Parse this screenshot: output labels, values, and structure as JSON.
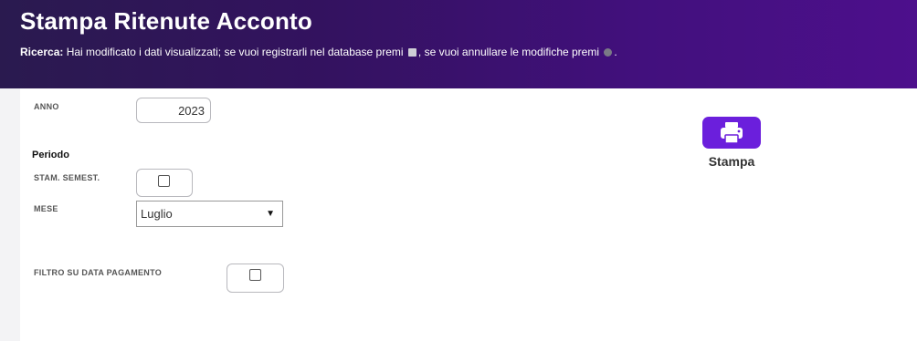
{
  "header": {
    "title": "Stampa Ritenute Acconto",
    "info_prefix": "Ricerca:",
    "info_text_1": "Hai modificato i dati visualizzati; se vuoi registrarli nel database premi",
    "info_text_2": ", se vuoi annullare le modifiche premi",
    "info_text_3": ".",
    "save_icon": "save-icon",
    "undo_icon": "undo-icon"
  },
  "form": {
    "anno_label": "ANNO",
    "anno_value": "2023",
    "periodo_label": "Periodo",
    "stam_semest_label": "STAM. SEMEST.",
    "stam_semest_checked": false,
    "mese_label": "MESE",
    "mese_value": "Luglio",
    "filtro_label": "FILTRO SU DATA PAGAMENTO",
    "filtro_checked": false
  },
  "actions": {
    "print_label": "Stampa",
    "print_icon": "printer-icon"
  },
  "colors": {
    "header_start": "#2a1a4f",
    "header_end": "#4d0f8c",
    "accent": "#6b1fdc"
  }
}
